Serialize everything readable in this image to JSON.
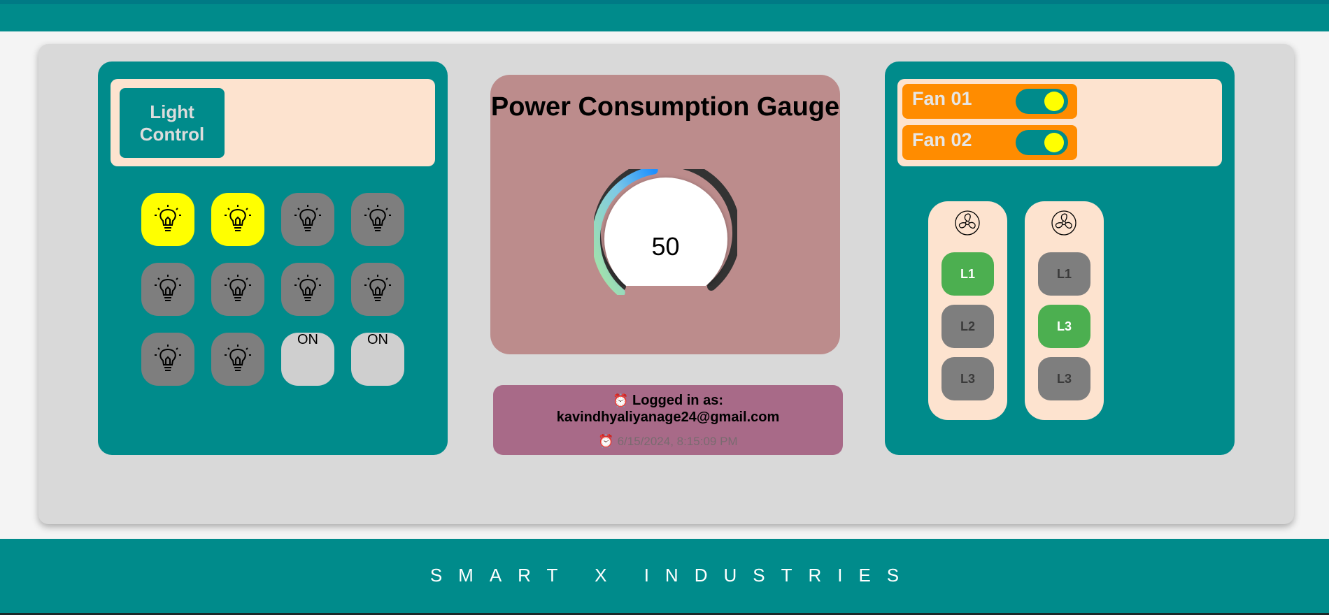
{
  "light_control": {
    "title_line1": "Light",
    "title_line2": "Control",
    "bulbs": [
      {
        "state": "on"
      },
      {
        "state": "on"
      },
      {
        "state": "off"
      },
      {
        "state": "off"
      },
      {
        "state": "off"
      },
      {
        "state": "off"
      },
      {
        "state": "off"
      },
      {
        "state": "off"
      },
      {
        "state": "off"
      },
      {
        "state": "off"
      },
      {
        "state": "blank",
        "label": "ON"
      },
      {
        "state": "blank",
        "label": "ON"
      }
    ]
  },
  "gauge": {
    "title": "Power Consumption Gauge",
    "value": "50",
    "level_fraction": 0.5
  },
  "login": {
    "label": "Logged in as:",
    "email": "kavindhyaliyanage24@gmail.com",
    "timestamp": "6/15/2024, 8:15:09 PM",
    "icon": "alarm-clock-icon"
  },
  "fans": {
    "items": [
      {
        "label": "Fan 01",
        "toggle": "on"
      },
      {
        "label": "Fan 02",
        "toggle": "on"
      }
    ],
    "columns": [
      {
        "levels": [
          {
            "label": "L1",
            "active": true
          },
          {
            "label": "L2",
            "active": false
          },
          {
            "label": "L3",
            "active": false
          }
        ]
      },
      {
        "levels": [
          {
            "label": "L1",
            "active": false
          },
          {
            "label": "L3",
            "active": true
          },
          {
            "label": "L3",
            "active": false
          }
        ]
      }
    ]
  },
  "footer": {
    "brand": "SMART X INDUSTRIES"
  },
  "colors": {
    "teal": "#008b8b",
    "peach": "#fde3cf",
    "bulb_on": "#ffff00",
    "bulb_off": "#7e7e7e",
    "fan_orange": "#ff8c00",
    "level_active": "#4caf50",
    "gauge_card": "#bc8c8c",
    "login_card": "#a86a88"
  }
}
